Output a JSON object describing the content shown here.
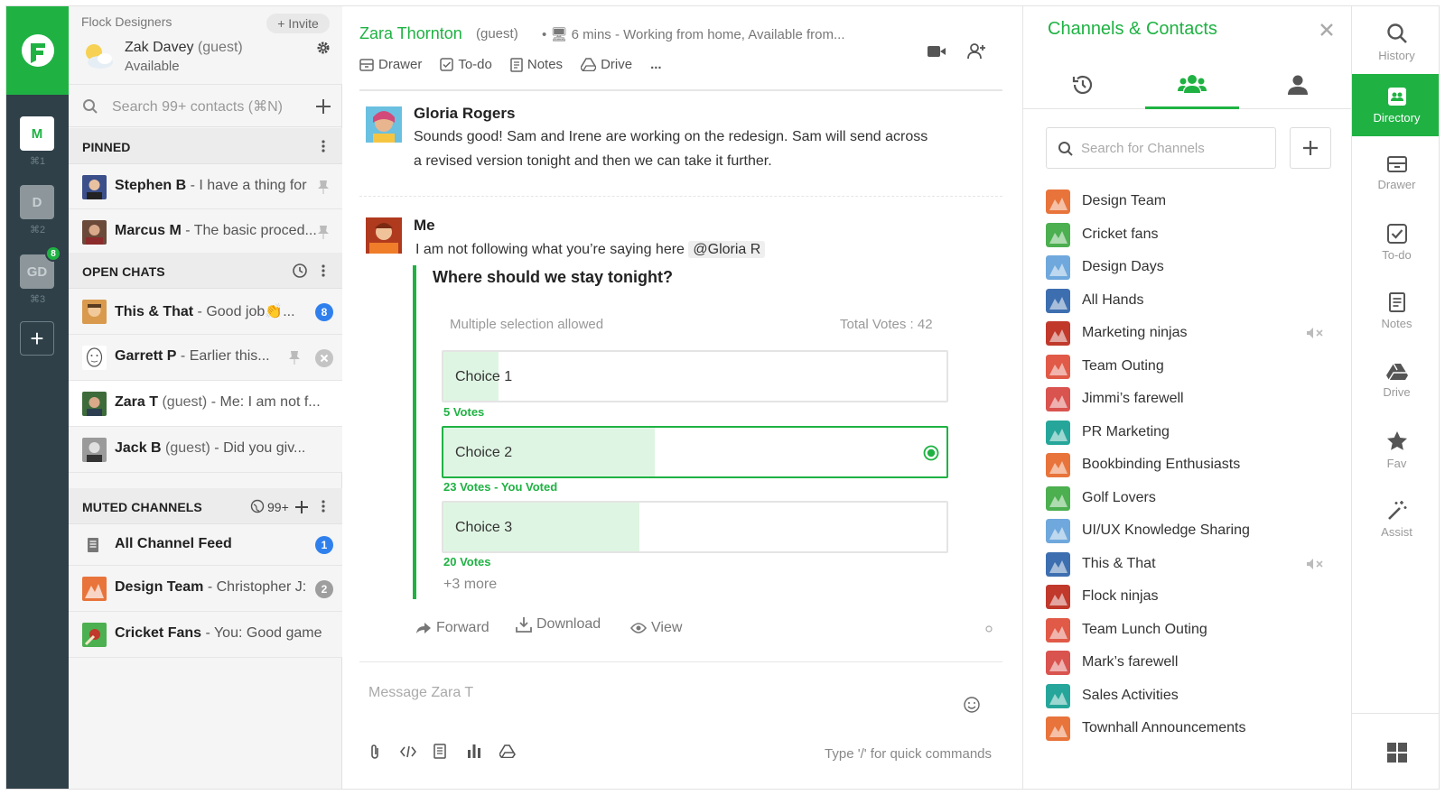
{
  "rail": {
    "teams": [
      {
        "initials": "M",
        "shortcut": "⌘1"
      },
      {
        "initials": "D",
        "shortcut": "⌘2"
      },
      {
        "initials": "GD",
        "shortcut": "⌘3",
        "badge": "8"
      }
    ],
    "add_label": "+"
  },
  "sidebar": {
    "team_name": "Flock Designers",
    "invite_label": "+ Invite",
    "user": {
      "name": "Zak Davey",
      "guest": "(guest)",
      "status": "Available"
    },
    "search_placeholder": "Search 99+ contacts (⌘N)",
    "pinned_title": "PINNED",
    "pinned": [
      {
        "name": "Stephen B",
        "preview": " - I have a thing for"
      },
      {
        "name": "Marcus M",
        "preview": " - The basic proced..."
      }
    ],
    "open_title": "OPEN CHATS",
    "open": [
      {
        "name": "This & That",
        "preview": " - Good job👏...",
        "badge": "8"
      },
      {
        "name": "Garrett P",
        "preview": " - Earlier this..."
      },
      {
        "name": "Zara T",
        "guest": " (guest)",
        "preview": " - Me: I am not f..."
      },
      {
        "name": "Jack B",
        "guest": " (guest)",
        "preview": " - Did you giv..."
      }
    ],
    "muted_title": "MUTED CHANNELS",
    "muted_count": "99+",
    "muted": [
      {
        "name": "All Channel Feed",
        "preview": "",
        "badge": "1"
      },
      {
        "name": "Design Team",
        "preview": " - Christopher J:",
        "badge": "2"
      },
      {
        "name": "Cricket Fans",
        "preview": " - You: Good game"
      }
    ]
  },
  "chat": {
    "name": "Zara Thornton",
    "guest": "(guest)",
    "status": "• 🖥 6 mins - Working from home, Available from...",
    "tabs": [
      "Drawer",
      "To-do",
      "Notes",
      "Drive",
      "..."
    ],
    "messages": [
      {
        "author": "Gloria Rogers",
        "lines": [
          "Sounds good! Sam and Irene are working on the redesign. Sam will send across",
          "a revised version tonight and then we can take it further."
        ]
      },
      {
        "author": "Me",
        "text": "I am not following what you’re saying here",
        "mention": "@Gloria R"
      }
    ],
    "poll": {
      "question": "Where should we stay tonight?",
      "note": "Multiple selection allowed",
      "total": "Total Votes : 42",
      "choices": [
        {
          "label": "Choice 1",
          "votes_text": "5 Votes",
          "fraction": 0.11
        },
        {
          "label": "Choice 2",
          "votes_text": "23 Votes - You Voted",
          "fraction": 0.42
        },
        {
          "label": "Choice 3",
          "votes_text": "20 Votes",
          "fraction": 0.39
        }
      ],
      "more": "+3 more"
    },
    "actions": [
      "Forward",
      "Download",
      "View"
    ],
    "composer_placeholder": "Message Zara T",
    "hint": "Type '/' for quick commands"
  },
  "panel": {
    "title": "Channels & Contacts",
    "search_placeholder": "Search for Channels",
    "channels": [
      {
        "name": "Design Team",
        "color": "#e8743b"
      },
      {
        "name": "Cricket fans",
        "color": "#4caf50"
      },
      {
        "name": "Design Days",
        "color": "#6fa8dc"
      },
      {
        "name": "All Hands",
        "color": "#3d6fb0"
      },
      {
        "name": "Marketing ninjas",
        "color": "#c0392b",
        "muted": true
      },
      {
        "name": "Team Outing",
        "color": "#e05a47"
      },
      {
        "name": "Jimmi’s farewell",
        "color": "#d9534f"
      },
      {
        "name": "PR Marketing",
        "color": "#26a69a"
      },
      {
        "name": "Bookbinding Enthusiasts",
        "color": "#e8743b"
      },
      {
        "name": "Golf Lovers",
        "color": "#4caf50"
      },
      {
        "name": "UI/UX Knowledge Sharing",
        "color": "#6fa8dc"
      },
      {
        "name": "This & That",
        "color": "#3d6fb0",
        "muted": true
      },
      {
        "name": "Flock ninjas",
        "color": "#c0392b"
      },
      {
        "name": "Team Lunch Outing",
        "color": "#e05a47"
      },
      {
        "name": "Mark’s farewell",
        "color": "#d9534f"
      },
      {
        "name": "Sales Activities",
        "color": "#26a69a"
      },
      {
        "name": "Townhall Announcements",
        "color": "#e8743b"
      }
    ]
  },
  "tools": [
    "History",
    "Directory",
    "Drawer",
    "To-do",
    "Notes",
    "Drive",
    "Fav",
    "Assist"
  ],
  "colors": {
    "brand": "#1fb243",
    "rail": "#2f4048",
    "badge_blue": "#2f80ed",
    "badge_grey": "#9e9e9e"
  }
}
